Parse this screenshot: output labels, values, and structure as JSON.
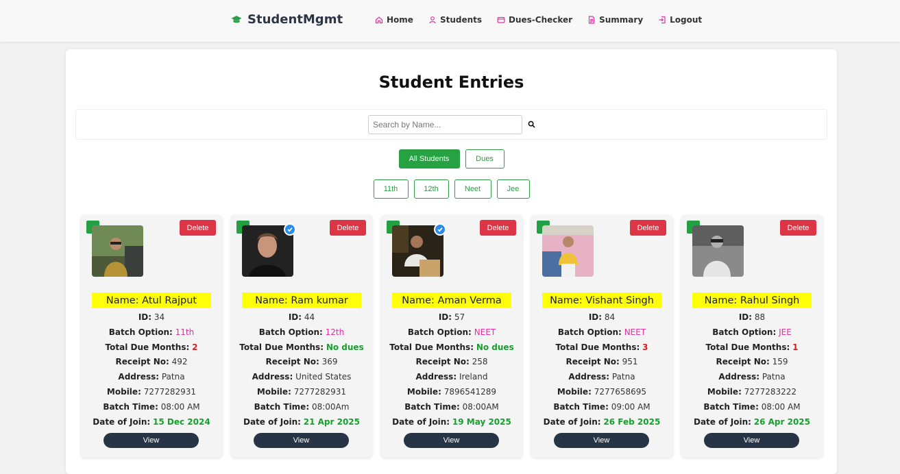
{
  "brand": {
    "name": "StudentMgmt"
  },
  "nav": [
    {
      "label": "Home",
      "icon": "home-icon"
    },
    {
      "label": "Students",
      "icon": "user-icon"
    },
    {
      "label": "Dues-Checker",
      "icon": "wallet-icon"
    },
    {
      "label": "Summary",
      "icon": "document-icon"
    },
    {
      "label": "Logout",
      "icon": "logout-icon"
    }
  ],
  "page": {
    "title": "Student Entries"
  },
  "search": {
    "placeholder": "Search by Name..."
  },
  "filters": {
    "primary": [
      "All Students",
      "Dues"
    ],
    "batch": [
      "11th",
      "12th",
      "Neet",
      "Jee"
    ]
  },
  "labels": {
    "delete": "Delete",
    "view": "View",
    "id": "ID:",
    "batch": "Batch Option:",
    "due": "Total Due Months:",
    "receipt": "Receipt No:",
    "address": "Address:",
    "mobile": "Mobile:",
    "time": "Batch Time:",
    "join": "Date of Join:"
  },
  "students": [
    {
      "name": "Name: Atul Rajput",
      "id": "34",
      "batch": "11th",
      "due": "2",
      "receipt": "492",
      "address": "Patna",
      "mobile": "7277282931",
      "time": "08:00 AM",
      "join": "15 Dec 2024",
      "verified": false
    },
    {
      "name": "Name: Ram kumar",
      "id": "44",
      "batch": "12th",
      "due": "No dues",
      "receipt": "369",
      "address": "United States",
      "mobile": "7277282931",
      "time": "08:00Am",
      "join": "21 Apr 2025",
      "verified": true
    },
    {
      "name": "Name: Aman Verma",
      "id": "57",
      "batch": "NEET",
      "due": "No dues",
      "receipt": "258",
      "address": "Ireland",
      "mobile": "7896541289",
      "time": "08:00AM",
      "join": "19 May 2025",
      "verified": true
    },
    {
      "name": "Name: Vishant Singh",
      "id": "84",
      "batch": "NEET",
      "due": "3",
      "receipt": "951",
      "address": "Patna",
      "mobile": "7277658695",
      "time": "09:00 AM",
      "join": "26 Feb 2025",
      "verified": false
    },
    {
      "name": "Name: Rahul Singh",
      "id": "88",
      "batch": "JEE",
      "due": "1",
      "receipt": "159",
      "address": "Patna",
      "mobile": "7277283222",
      "time": "08:00 AM",
      "join": "26 Apr 2025",
      "verified": false
    }
  ],
  "colors": {
    "accent": "#27a243",
    "danger": "#dc3545",
    "dark": "#263445",
    "highlight": "#ffff0a",
    "pink": "#e2309e"
  }
}
